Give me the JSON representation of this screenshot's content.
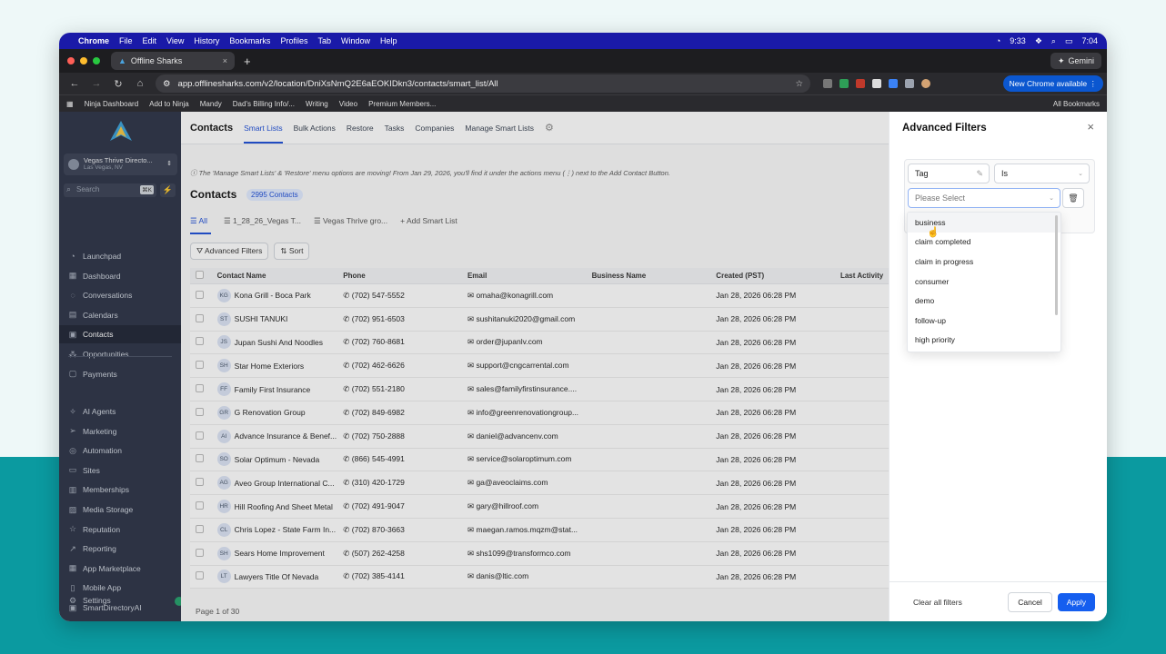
{
  "colors": {
    "accent": "#155eef",
    "sidebar_bg": "#2c3346",
    "teal_bg": "#0b9aa0",
    "menubar_bg": "#1a1aa8"
  },
  "macos_menubar": {
    "items": [
      "Chrome",
      "File",
      "Edit",
      "View",
      "History",
      "Bookmarks",
      "Profiles",
      "Tab",
      "Window",
      "Help"
    ],
    "clock_small": "9:33",
    "time": "7:04"
  },
  "browser": {
    "tab_title": "Offline Sharks",
    "tab_close": "×",
    "gemini_label": "Gemini",
    "url": "app.offlinesharks.com/v2/location/DniXsNmQ2E6aEOKIDkn3/contacts/smart_list/All",
    "new_chrome_label": "New Chrome available",
    "bookmarks": [
      "Ninja Dashboard",
      "Add to Ninja",
      "Mandy",
      "Dad's Billing Info/...",
      "Writing",
      "Video",
      "Premium Members..."
    ],
    "all_bookmarks": "All Bookmarks"
  },
  "sidebar": {
    "location_name": "Vegas Thrive Directo...",
    "location_sub": "Las Vegas, NV",
    "search_placeholder": "Search",
    "search_kbd": "⌘K",
    "items_top": [
      {
        "label": "Launchpad",
        "icon": "rocket-icon",
        "glyph": "◔"
      },
      {
        "label": "Dashboard",
        "icon": "dashboard-icon",
        "glyph": "▦"
      },
      {
        "label": "Conversations",
        "icon": "chat-icon",
        "glyph": "◌"
      },
      {
        "label": "Calendars",
        "icon": "calendar-icon",
        "glyph": "▤"
      },
      {
        "label": "Contacts",
        "icon": "contacts-icon",
        "glyph": "▣"
      },
      {
        "label": "Opportunities",
        "icon": "opportunities-icon",
        "glyph": "⁂"
      },
      {
        "label": "Payments",
        "icon": "payments-icon",
        "glyph": "▢"
      }
    ],
    "items_bottom": [
      {
        "label": "AI Agents",
        "icon": "sparkle-icon",
        "glyph": "✧"
      },
      {
        "label": "Marketing",
        "icon": "send-icon",
        "glyph": "➢"
      },
      {
        "label": "Automation",
        "icon": "automation-icon",
        "glyph": "◎"
      },
      {
        "label": "Sites",
        "icon": "sites-icon",
        "glyph": "▭"
      },
      {
        "label": "Memberships",
        "icon": "memberships-icon",
        "glyph": "▥"
      },
      {
        "label": "Media Storage",
        "icon": "media-icon",
        "glyph": "▨"
      },
      {
        "label": "Reputation",
        "icon": "star-icon",
        "glyph": "☆"
      },
      {
        "label": "Reporting",
        "icon": "chart-icon",
        "glyph": "↗"
      },
      {
        "label": "App Marketplace",
        "icon": "marketplace-icon",
        "glyph": "▦"
      },
      {
        "label": "Mobile App",
        "icon": "mobile-icon",
        "glyph": "▯"
      },
      {
        "label": "SmartDirectoryAI",
        "icon": "directory-icon",
        "glyph": "▣"
      }
    ],
    "settings_label": "Settings"
  },
  "main": {
    "top_title": "Contacts",
    "top_tabs": [
      "Smart Lists",
      "Bulk Actions",
      "Restore",
      "Tasks",
      "Companies",
      "Manage Smart Lists"
    ],
    "notice": "ⓘ The 'Manage Smart Lists' & 'Restore' menu options are moving! From Jan 29, 2026, you'll find it under the actions menu (⋮) next to the Add Contact Button.",
    "heading": "Contacts",
    "count_badge": "2995 Contacts",
    "smart_tabs": [
      "All",
      "1_28_26_Vegas T...",
      "Vegas Thrive gro...",
      "Add Smart List"
    ],
    "advanced_filters_btn": "Advanced Filters",
    "sort_btn": "Sort",
    "columns": [
      "Contact Name",
      "Phone",
      "Email",
      "Business Name",
      "Created (PST)",
      "Last Activity"
    ],
    "rows": [
      {
        "initials": "KG",
        "name": "Kona Grill - Boca Park",
        "phone": "(702) 547-5552",
        "email": "omaha@konagrill.com",
        "business": "",
        "created": "Jan 28, 2026 06:28 PM"
      },
      {
        "initials": "ST",
        "name": "SUSHI TANUKI",
        "phone": "(702) 951-6503",
        "email": "sushitanuki2020@gmail.com",
        "business": "",
        "created": "Jan 28, 2026 06:28 PM"
      },
      {
        "initials": "JS",
        "name": "Jupan Sushi And Noodles",
        "phone": "(702) 760-8681",
        "email": "order@jupanlv.com",
        "business": "",
        "created": "Jan 28, 2026 06:28 PM"
      },
      {
        "initials": "SH",
        "name": "Star Home Exteriors",
        "phone": "(702) 462-6626",
        "email": "support@cngcarrental.com",
        "business": "",
        "created": "Jan 28, 2026 06:28 PM"
      },
      {
        "initials": "FF",
        "name": "Family First Insurance",
        "phone": "(702) 551-2180",
        "email": "sales@familyfirstinsurance....",
        "business": "",
        "created": "Jan 28, 2026 06:28 PM"
      },
      {
        "initials": "GR",
        "name": "G Renovation Group",
        "phone": "(702) 849-6982",
        "email": "info@greenrenovationgroup...",
        "business": "",
        "created": "Jan 28, 2026 06:28 PM"
      },
      {
        "initials": "AI",
        "name": "Advance Insurance & Benef...",
        "phone": "(702) 750-2888",
        "email": "daniel@advancenv.com",
        "business": "",
        "created": "Jan 28, 2026 06:28 PM"
      },
      {
        "initials": "SO",
        "name": "Solar Optimum - Nevada",
        "phone": "(866) 545-4991",
        "email": "service@solaroptimum.com",
        "business": "",
        "created": "Jan 28, 2026 06:28 PM"
      },
      {
        "initials": "AG",
        "name": "Aveo Group International C...",
        "phone": "(310) 420-1729",
        "email": "ga@aveoclaims.com",
        "business": "",
        "created": "Jan 28, 2026 06:28 PM"
      },
      {
        "initials": "HR",
        "name": "Hill Roofing And Sheet Metal",
        "phone": "(702) 491-9047",
        "email": "gary@hillroof.com",
        "business": "",
        "created": "Jan 28, 2026 06:28 PM"
      },
      {
        "initials": "CL",
        "name": "Chris Lopez - State Farm In...",
        "phone": "(702) 870-3663",
        "email": "maegan.ramos.mqzm@stat...",
        "business": "",
        "created": "Jan 28, 2026 06:28 PM"
      },
      {
        "initials": "SH",
        "name": "Sears Home Improvement",
        "phone": "(507) 262-4258",
        "email": "shs1099@transformco.com",
        "business": "",
        "created": "Jan 28, 2026 06:28 PM"
      },
      {
        "initials": "LT",
        "name": "Lawyers Title Of Nevada",
        "phone": "(702) 385-4141",
        "email": "danis@ltic.com",
        "business": "",
        "created": "Jan 28, 2026 06:28 PM"
      }
    ],
    "pager": "Page 1 of 30"
  },
  "panel": {
    "title": "Advanced Filters",
    "field": "Tag",
    "operator": "Is",
    "value_placeholder": "Please Select",
    "options": [
      "business",
      "claim completed",
      "claim in progress",
      "consumer",
      "demo",
      "follow-up",
      "high priority"
    ],
    "clear_all": "Clear all filters",
    "cancel": "Cancel",
    "apply": "Apply"
  }
}
